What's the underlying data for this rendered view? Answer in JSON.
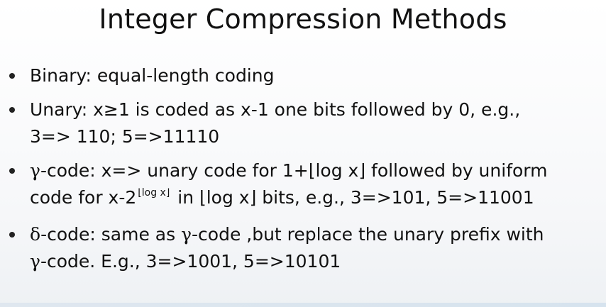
{
  "slide": {
    "title": "Integer Compression Methods",
    "bullets": [
      {
        "lines": [
          [
            "Binary: equal-length coding"
          ]
        ]
      },
      {
        "lines": [
          [
            "Unary: x≥1 is coded as x-1 one bits followed by 0, e.g.,"
          ],
          [
            "3=> 110; 5=>11110"
          ]
        ]
      },
      {
        "lines": [
          [
            "γ",
            "-code: x=> unary code for 1+⌊log x⌋ followed by  uniform"
          ],
          [
            "code for x-2",
            "⌊log x⌋",
            " in ⌊log x⌋  bits, e.g., 3=>101, 5=>11001"
          ]
        ]
      },
      {
        "lines": [
          [
            "δ",
            "-code: same as ",
            "γ",
            "-code ,but replace the unary prefix with"
          ],
          [
            "γ",
            "-code. E.g., 3=>1001, 5=>10101"
          ]
        ]
      }
    ]
  }
}
